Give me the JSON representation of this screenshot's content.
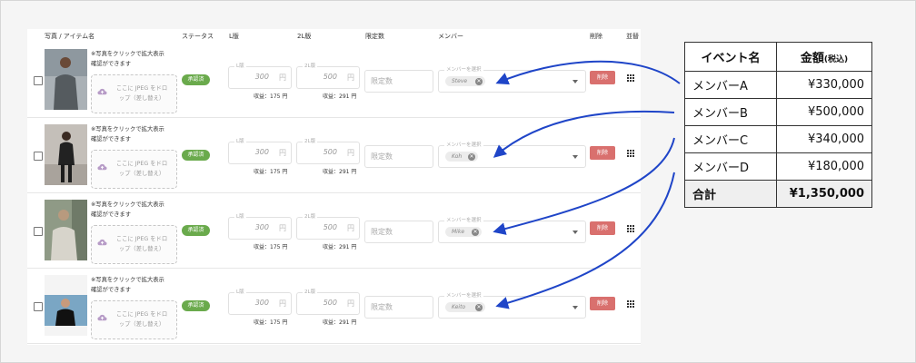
{
  "headers": {
    "photo_item": "写真 / アイテム名",
    "status": "ステータス",
    "l_size": "L版",
    "twol_size": "2L版",
    "limit": "限定数",
    "member": "メンバー",
    "delete": "削除",
    "reorder": "並替"
  },
  "rows": [
    {
      "note_line1": "※写真をクリックで拡大表示",
      "note_line2": "確認ができます",
      "drop_line1": "ここに JPEG をドロ",
      "drop_line2": "ップ（差し替え）",
      "status": "承認済",
      "l_label": "L版",
      "l_value": "300",
      "l_unit": "円",
      "l_income": "収益：175 円",
      "twol_label": "2L版",
      "twol_value": "500",
      "twol_unit": "円",
      "twol_income": "収益：291 円",
      "limit_placeholder": "限定数",
      "member_label": "メンバーを選択",
      "member_chip": "Steve",
      "delete_label": "削除"
    },
    {
      "note_line1": "※写真をクリックで拡大表示",
      "note_line2": "確認ができます",
      "drop_line1": "ここに JPEG をドロ",
      "drop_line2": "ップ（差し替え）",
      "status": "承認済",
      "l_label": "L版",
      "l_value": "300",
      "l_unit": "円",
      "l_income": "収益：175 円",
      "twol_label": "2L版",
      "twol_value": "500",
      "twol_unit": "円",
      "twol_income": "収益：291 円",
      "limit_placeholder": "限定数",
      "member_label": "メンバーを選択",
      "member_chip": "Koh",
      "delete_label": "削除"
    },
    {
      "note_line1": "※写真をクリックで拡大表示",
      "note_line2": "確認ができます",
      "drop_line1": "ここに JPEG をドロ",
      "drop_line2": "ップ（差し替え）",
      "status": "承認済",
      "l_label": "L版",
      "l_value": "300",
      "l_unit": "円",
      "l_income": "収益：175 円",
      "twol_label": "2L版",
      "twol_value": "500",
      "twol_unit": "円",
      "twol_income": "収益：291 円",
      "limit_placeholder": "限定数",
      "member_label": "メンバーを選択",
      "member_chip": "Mike",
      "delete_label": "削除"
    },
    {
      "note_line1": "※写真をクリックで拡大表示",
      "note_line2": "確認ができます",
      "drop_line1": "ここに JPEG をドロ",
      "drop_line2": "ップ（差し替え）",
      "status": "承認済",
      "l_label": "L版",
      "l_value": "300",
      "l_unit": "円",
      "l_income": "収益：175 円",
      "twol_label": "2L版",
      "twol_value": "500",
      "twol_unit": "円",
      "twol_income": "収益：291 円",
      "limit_placeholder": "限定数",
      "member_label": "メンバーを選択",
      "member_chip": "Keito",
      "delete_label": "削除"
    }
  ],
  "summary": {
    "col_event": "イベント名",
    "col_amount": "金額",
    "col_amount_note": "(税込)",
    "rows": [
      {
        "name": "メンバーA",
        "amount": "¥330,000"
      },
      {
        "name": "メンバーB",
        "amount": "¥500,000"
      },
      {
        "name": "メンバーC",
        "amount": "¥340,000"
      },
      {
        "name": "メンバーD",
        "amount": "¥180,000"
      }
    ],
    "total_label": "合計",
    "total_amount": "¥1,350,000"
  },
  "colors": {
    "status_green": "#6aaa4c",
    "delete_red": "#d9706e",
    "arrow_blue": "#1f45c8"
  },
  "icons": {
    "upload": "cloud-upload-icon",
    "chip_remove": "close-circle-icon",
    "dropdown": "chevron-down-icon",
    "reorder": "drag-grip-icon"
  }
}
